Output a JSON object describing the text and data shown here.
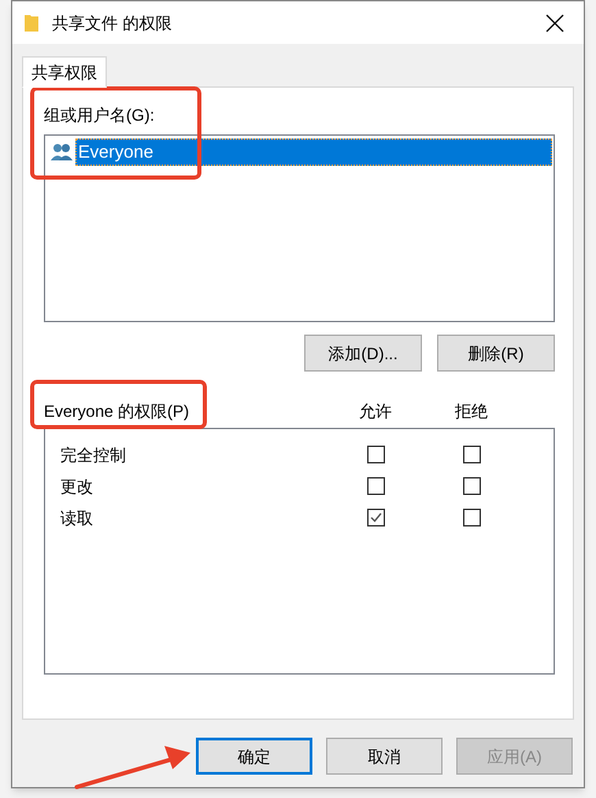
{
  "window": {
    "title": "共享文件 的权限"
  },
  "tabs": [
    {
      "label": "共享权限",
      "selected": true
    }
  ],
  "groups": {
    "label": "组或用户名(G):",
    "items": [
      {
        "name": "Everyone",
        "selected": true
      }
    ]
  },
  "group_buttons": [
    {
      "label": "添加(D)...",
      "disabled": false
    },
    {
      "label": "删除(R)",
      "disabled": false
    }
  ],
  "permissions": {
    "label": "Everyone 的权限(P)",
    "columns": [
      "允许",
      "拒绝"
    ],
    "rows": [
      {
        "name": "完全控制",
        "allow": false,
        "deny": false
      },
      {
        "name": "更改",
        "allow": false,
        "deny": false
      },
      {
        "name": "读取",
        "allow": true,
        "deny": false
      }
    ]
  },
  "buttons": [
    {
      "label": "确定",
      "default": true,
      "disabled": false
    },
    {
      "label": "取消",
      "default": false,
      "disabled": false
    },
    {
      "label": "应用(A)",
      "default": false,
      "disabled": true
    }
  ],
  "annotations": [
    {
      "kind": "box"
    },
    {
      "kind": "box"
    },
    {
      "kind": "arrow"
    }
  ]
}
